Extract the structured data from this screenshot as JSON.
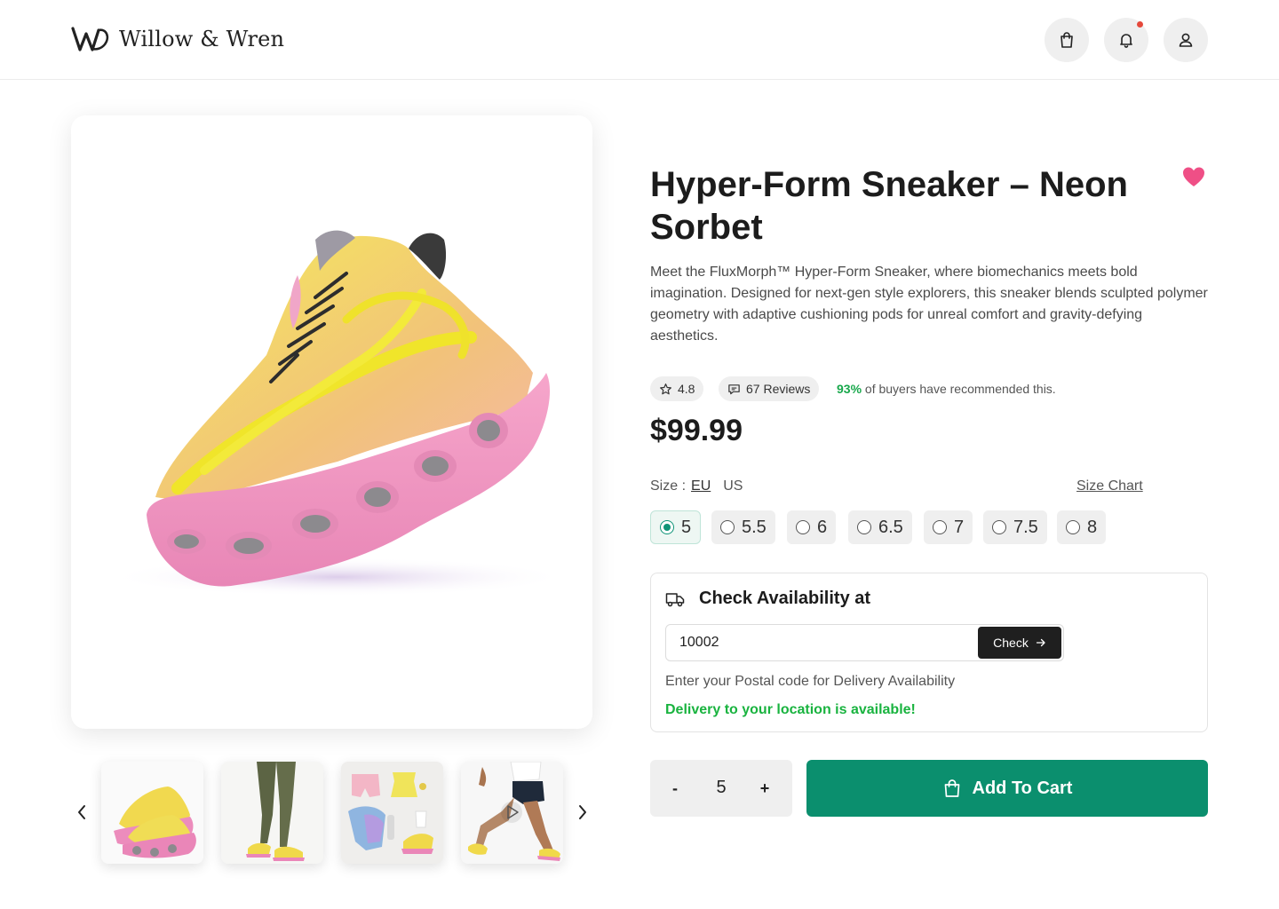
{
  "brand": {
    "name": "Willow & Wren"
  },
  "header": {
    "icons": [
      "shopping-bag-icon",
      "bell-icon",
      "user-icon"
    ],
    "notification_dot_color": "#e5483b"
  },
  "gallery": {
    "main_image": "pink-and-yellow-sculpted-sneaker",
    "thumbnails": [
      "sneaker-pair",
      "legs-wearing-sneakers",
      "outfit-flatlay",
      "runner-in-motion"
    ],
    "prev_icon": "chevron-left-icon",
    "next_icon": "chevron-right-icon"
  },
  "product": {
    "title": "Hyper-Form Sneaker – Neon Sorbet",
    "description": "Meet the FluxMorph™ Hyper-Form Sneaker, where biomechanics meets bold imagination. Designed for next-gen style explorers, this sneaker blends sculpted polymer geometry with adaptive cushioning pods for unreal comfort and gravity-defying aesthetics.",
    "rating": "4.8",
    "reviews": "67 Reviews",
    "recommend_pct": "93%",
    "recommend_text": "of buyers have recommended this.",
    "price": "$99.99",
    "wishlist_color": "#ef4f86"
  },
  "size": {
    "label": "Size :",
    "units": [
      "EU",
      "US"
    ],
    "active_unit": "EU",
    "chart_label": "Size Chart",
    "options": [
      "5",
      "5.5",
      "6",
      "6.5",
      "7",
      "7.5",
      "8"
    ],
    "selected": "5"
  },
  "availability": {
    "title": "Check Availability at",
    "postal_value": "10002",
    "check_label": "Check",
    "hint": "Enter your Postal code for Delivery Availability",
    "status": "Delivery to your location is available!",
    "status_color": "#19b33f"
  },
  "cart": {
    "quantity": "5",
    "minus": "-",
    "plus": "+",
    "add_label": "Add To Cart",
    "button_color": "#0b8f6e"
  }
}
